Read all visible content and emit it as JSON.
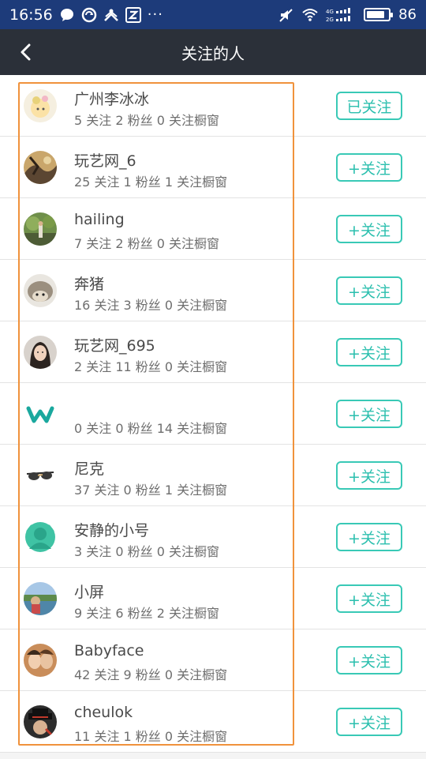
{
  "status_bar": {
    "time": "16:56",
    "battery_level": "86",
    "battery_fraction": 0.86,
    "icons": [
      "chat-bubble-icon",
      "sync-icon",
      "network-share-icon",
      "z-app-icon",
      "more-dots-icon",
      "mute-icon",
      "wifi-icon",
      "signal-icon",
      "battery-icon"
    ],
    "more": "···",
    "signal_labels": [
      "4G",
      "2G"
    ]
  },
  "header": {
    "title": "关注的人",
    "back_icon": "chevron-left-icon"
  },
  "colors": {
    "status_bar_bg": "#1d3b7a",
    "app_bar_bg": "#2b3039",
    "accent": "#39c9b6",
    "highlight": "#f0923c"
  },
  "users": [
    {
      "name": "广州李冰冰",
      "stats": "5 关注 2 粉丝 0 关注橱窗",
      "button": "已关注",
      "avatar": "cartoon-avatar"
    },
    {
      "name": "玩艺网_6",
      "stats": "25 关注 1 粉丝 1 关注橱窗",
      "button": "+关注",
      "avatar": "artwork-avatar"
    },
    {
      "name": "hailing",
      "stats": "7 关注 2 粉丝 0 关注橱窗",
      "button": "+关注",
      "avatar": "outdoor-photo-avatar"
    },
    {
      "name": "奔猪",
      "stats": "16 关注 3 粉丝 0 关注橱窗",
      "button": "+关注",
      "avatar": "hedgehog-avatar"
    },
    {
      "name": "玩艺网_695",
      "stats": "2 关注 11 粉丝 0 关注橱窗",
      "button": "+关注",
      "avatar": "portrait-avatar"
    },
    {
      "name": "",
      "stats": "0 关注 0 粉丝 14 关注橱窗",
      "button": "+关注",
      "avatar": "w-logo-avatar"
    },
    {
      "name": "尼克",
      "stats": "37 关注 0 粉丝 1 关注橱窗",
      "button": "+关注",
      "avatar": "sunglasses-avatar"
    },
    {
      "name": "安静的小号",
      "stats": "3 关注 0 粉丝 0 关注橱窗",
      "button": "+关注",
      "avatar": "default-green-avatar"
    },
    {
      "name": "小屏",
      "stats": "9 关注 6 粉丝 2 关注橱窗",
      "button": "+关注",
      "avatar": "lake-photo-avatar"
    },
    {
      "name": "Babyface",
      "stats": "42 关注 9 粉丝 0 关注橱窗",
      "button": "+关注",
      "avatar": "selfie-avatar"
    },
    {
      "name": "cheulok",
      "stats": "11 关注 1 粉丝 0 关注橱窗",
      "button": "+关注",
      "avatar": "hat-person-avatar"
    }
  ]
}
